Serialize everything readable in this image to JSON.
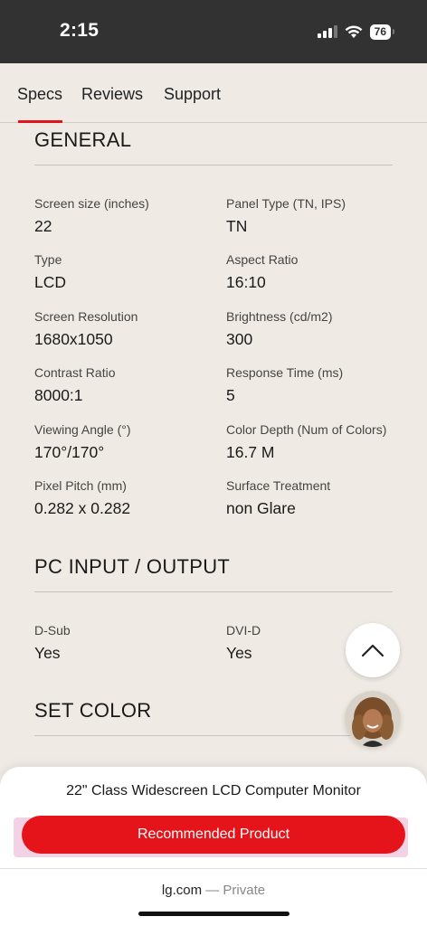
{
  "status_bar": {
    "time": "2:15",
    "battery": "76"
  },
  "tabs": [
    {
      "label": "Specs",
      "active": true
    },
    {
      "label": "Reviews",
      "active": false
    },
    {
      "label": "Support",
      "active": false
    }
  ],
  "sections": {
    "general": {
      "title": "GENERAL",
      "specs": [
        {
          "label": "Screen size (inches)",
          "value": "22"
        },
        {
          "label": "Panel Type (TN, IPS)",
          "value": "TN"
        },
        {
          "label": "Type",
          "value": "LCD"
        },
        {
          "label": "Aspect Ratio",
          "value": "16:10"
        },
        {
          "label": "Screen Resolution",
          "value": "1680x1050"
        },
        {
          "label": "Brightness (cd/m2)",
          "value": "300"
        },
        {
          "label": "Contrast Ratio",
          "value": "8000:1"
        },
        {
          "label": "Response Time (ms)",
          "value": "5"
        },
        {
          "label": "Viewing Angle (°)",
          "value": "170°/170°"
        },
        {
          "label": "Color Depth (Num of Colors)",
          "value": "16.7 M"
        },
        {
          "label": "Pixel Pitch (mm)",
          "value": "0.282 x 0.282"
        },
        {
          "label": "Surface Treatment",
          "value": "non Glare"
        }
      ]
    },
    "pc_io": {
      "title": "PC INPUT / OUTPUT",
      "specs": [
        {
          "label": "D-Sub",
          "value": "Yes"
        },
        {
          "label": "DVI-D",
          "value": "Yes"
        }
      ]
    },
    "set_color": {
      "title": "SET COLOR"
    }
  },
  "floating": {
    "scroll_top_icon": "chevron-up-icon",
    "chat_avatar": "agent-avatar"
  },
  "bottom_sheet": {
    "product_title": "22\" Class Widescreen LCD Computer Monitor",
    "cta_label": "Recommended Product",
    "cta_color": "#e5141a"
  },
  "browser": {
    "domain": "lg.com",
    "mode": "— Private"
  },
  "colors": {
    "accent": "#e3121f",
    "background": "#efebe4"
  }
}
